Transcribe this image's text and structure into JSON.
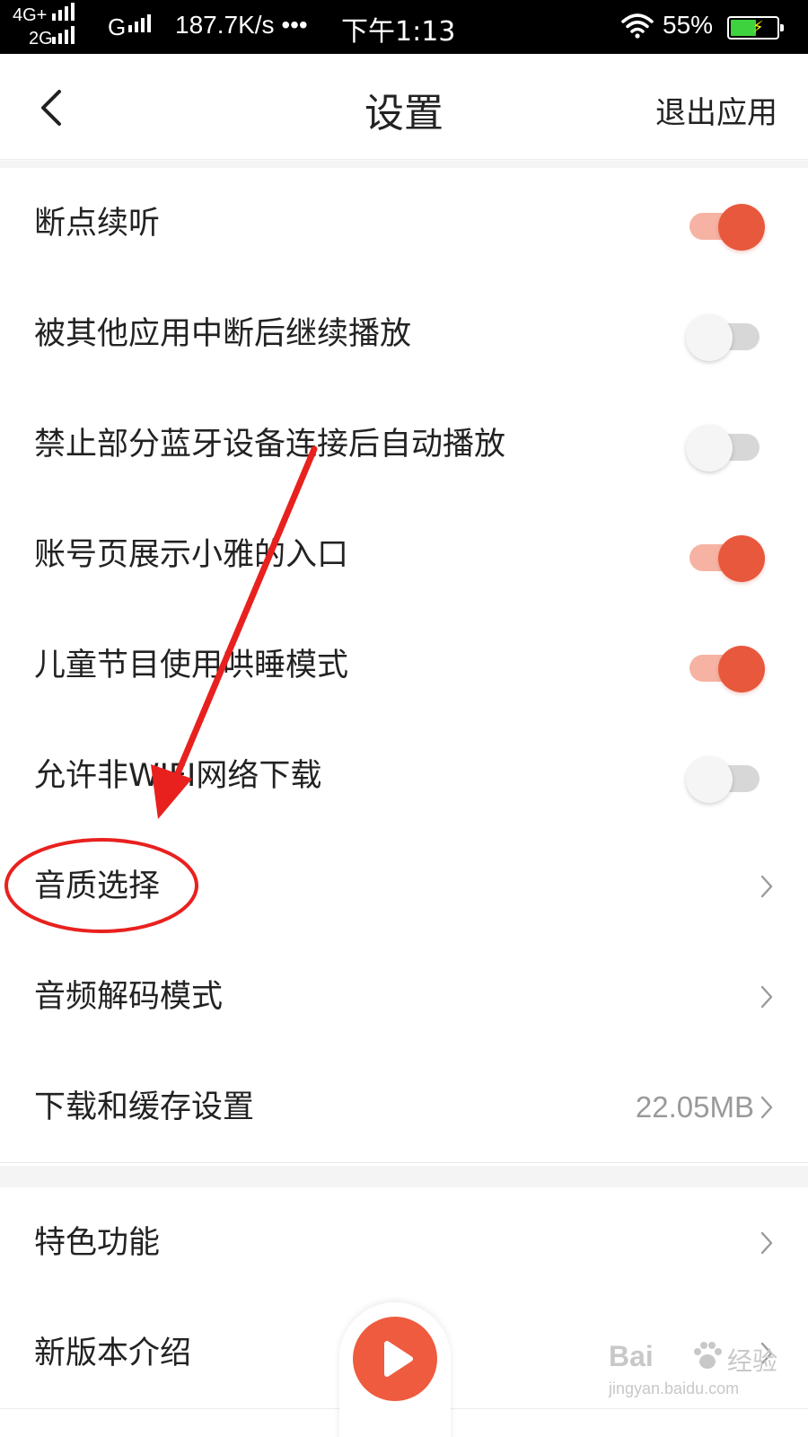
{
  "status_bar": {
    "network_1": "4G+",
    "network_2": "2G",
    "network_3": "G",
    "speed": "187.7K/s",
    "more": "•••",
    "time": "下午1:13",
    "battery": "55%",
    "battery_level": 0.55,
    "icons": [
      "signal-icon",
      "wifi-icon",
      "battery-icon"
    ]
  },
  "header": {
    "title": "设置",
    "exit_label": "退出应用",
    "back_icon": "chevron-left-icon"
  },
  "settings": [
    {
      "label": "断点续听",
      "type": "toggle",
      "on": true
    },
    {
      "label": "被其他应用中断后继续播放",
      "type": "toggle",
      "on": false
    },
    {
      "label": "禁止部分蓝牙设备连接后自动播放",
      "type": "toggle",
      "on": false
    },
    {
      "label": "账号页展示小雅的入口",
      "type": "toggle",
      "on": true
    },
    {
      "label": "儿童节目使用哄睡模式",
      "type": "toggle",
      "on": true
    },
    {
      "label": "允许非WIFI网络下载",
      "type": "toggle",
      "on": false
    },
    {
      "label": "音质选择",
      "type": "link"
    },
    {
      "label": "音频解码模式",
      "type": "link"
    },
    {
      "label": "下载和缓存设置",
      "type": "link",
      "value": "22.05MB"
    }
  ],
  "more_settings": [
    {
      "label": "特色功能",
      "type": "link"
    },
    {
      "label": "新版本介绍",
      "type": "link"
    }
  ],
  "player": {
    "icon": "play-icon"
  },
  "colors": {
    "accent": "#e8583c",
    "toggle_on_track": "#f6b3a3",
    "toggle_off_track": "#d7d7d7",
    "annotation": "#e8211f"
  },
  "watermark": {
    "brand": "Bai",
    "cn": "经验",
    "url": "jingyan.baidu.com"
  }
}
